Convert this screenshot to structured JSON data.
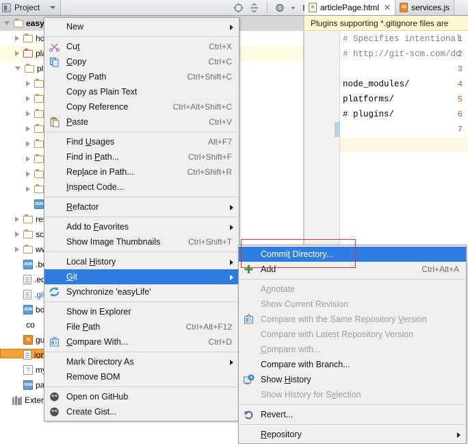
{
  "toolbar": {
    "project_label": "Project",
    "icons": [
      "target-icon",
      "collapse-all-icon",
      "settings-gear-icon",
      "hide-panel-icon"
    ]
  },
  "project_tree": {
    "rows": [
      {
        "label": "easyLi",
        "indent": 0,
        "twisty": "open",
        "icon": "folder",
        "state": "selected"
      },
      {
        "label": "ho",
        "indent": 1,
        "twisty": "closed",
        "icon": "folder",
        "state": "normal"
      },
      {
        "label": "pla",
        "indent": 1,
        "twisty": "closed",
        "icon": "folder-red",
        "state": "highlight"
      },
      {
        "label": "plu",
        "indent": 1,
        "twisty": "open",
        "icon": "folder",
        "state": "normal"
      },
      {
        "label": "",
        "indent": 2,
        "twisty": "closed",
        "icon": "folder",
        "state": "normal"
      },
      {
        "label": "",
        "indent": 2,
        "twisty": "closed",
        "icon": "folder",
        "state": "normal"
      },
      {
        "label": "",
        "indent": 2,
        "twisty": "closed",
        "icon": "folder",
        "state": "normal"
      },
      {
        "label": "",
        "indent": 2,
        "twisty": "closed",
        "icon": "folder",
        "state": "normal"
      },
      {
        "label": "",
        "indent": 2,
        "twisty": "closed",
        "icon": "folder",
        "state": "normal"
      },
      {
        "label": "",
        "indent": 2,
        "twisty": "closed",
        "icon": "folder",
        "state": "normal"
      },
      {
        "label": "",
        "indent": 2,
        "twisty": "closed",
        "icon": "folder",
        "state": "normal"
      },
      {
        "label": "",
        "indent": 2,
        "twisty": "closed",
        "icon": "folder",
        "state": "normal"
      },
      {
        "label": "",
        "indent": 2,
        "twisty": "none",
        "icon": "json",
        "state": "normal"
      },
      {
        "label": "res",
        "indent": 1,
        "twisty": "closed",
        "icon": "folder",
        "state": "normal"
      },
      {
        "label": "scs",
        "indent": 1,
        "twisty": "closed",
        "icon": "folder",
        "state": "normal"
      },
      {
        "label": "ww",
        "indent": 1,
        "twisty": "closed",
        "icon": "folder",
        "state": "normal"
      },
      {
        "label": ".bo",
        "indent": 1,
        "twisty": "none",
        "icon": "json",
        "state": "normal"
      },
      {
        "label": ".ed",
        "indent": 1,
        "twisty": "none",
        "icon": "file",
        "state": "normal"
      },
      {
        "label": ".git",
        "indent": 1,
        "twisty": "none",
        "icon": "file",
        "state": "link"
      },
      {
        "label": "bo",
        "indent": 1,
        "twisty": "none",
        "icon": "json",
        "state": "normal"
      },
      {
        "label": "co",
        "indent": 1,
        "twisty": "none",
        "icon": "code",
        "state": "normal"
      },
      {
        "label": "gu",
        "indent": 1,
        "twisty": "none",
        "icon": "js",
        "state": "normal"
      },
      {
        "label": "ion",
        "indent": 1,
        "twisty": "none",
        "icon": "file",
        "state": "normal"
      },
      {
        "label": "my",
        "indent": 1,
        "twisty": "none",
        "icon": "question",
        "state": "normal"
      },
      {
        "label": "pa",
        "indent": 1,
        "twisty": "none",
        "icon": "json",
        "state": "normal"
      },
      {
        "label": "Extern",
        "indent": 0,
        "twisty": "none",
        "icon": "library",
        "state": "normal"
      }
    ]
  },
  "editor": {
    "tabs": [
      {
        "label": "articlePage.html",
        "icon": "html-file-icon",
        "active": true,
        "closable": true
      },
      {
        "label": "services.js",
        "icon": "js-file-icon",
        "active": false,
        "closable": false
      }
    ],
    "notification": "Plugins supporting *.gitignore files are",
    "lines": [
      {
        "num": "1",
        "text": "# Specifies intentional",
        "kind": "comment"
      },
      {
        "num": "2",
        "text": "# http://git-scm.com/dc",
        "kind": "comment"
      },
      {
        "num": "3",
        "text": "",
        "kind": "plain"
      },
      {
        "num": "4",
        "text": "node_modules/",
        "kind": "plain"
      },
      {
        "num": "5",
        "text": "platforms/",
        "kind": "plain"
      },
      {
        "num": "6",
        "text": "# plugins/",
        "kind": "plain"
      },
      {
        "num": "7",
        "text": "",
        "kind": "plain"
      }
    ]
  },
  "context_menu": {
    "items": [
      {
        "label": "New",
        "accel": "",
        "icon": "",
        "arrow": true,
        "type": "item"
      },
      {
        "type": "separator"
      },
      {
        "label": "Cut",
        "accel": "Ctrl+X",
        "icon": "scissors-icon",
        "mnemonic": 2,
        "type": "item"
      },
      {
        "label": "Copy",
        "accel": "Ctrl+C",
        "icon": "copy-icon",
        "mnemonic": 0,
        "type": "item"
      },
      {
        "label": "Copy Path",
        "accel": "Ctrl+Shift+C",
        "icon": "",
        "mnemonic": 2,
        "type": "item"
      },
      {
        "label": "Copy as Plain Text",
        "accel": "",
        "icon": "",
        "type": "item"
      },
      {
        "label": "Copy Reference",
        "accel": "Ctrl+Alt+Shift+C",
        "icon": "",
        "type": "item"
      },
      {
        "label": "Paste",
        "accel": "Ctrl+V",
        "icon": "paste-icon",
        "mnemonic": 0,
        "type": "item"
      },
      {
        "type": "separator"
      },
      {
        "label": "Find Usages",
        "accel": "Alt+F7",
        "icon": "",
        "mnemonic": 5,
        "type": "item"
      },
      {
        "label": "Find in Path...",
        "accel": "Ctrl+Shift+F",
        "icon": "",
        "mnemonic": 8,
        "type": "item"
      },
      {
        "label": "Replace in Path...",
        "accel": "Ctrl+Shift+R",
        "icon": "",
        "mnemonic": 3,
        "type": "item"
      },
      {
        "label": "Inspect Code...",
        "accel": "",
        "icon": "",
        "mnemonic": 0,
        "type": "item"
      },
      {
        "type": "separator"
      },
      {
        "label": "Refactor",
        "accel": "",
        "icon": "",
        "arrow": true,
        "mnemonic": 0,
        "type": "item"
      },
      {
        "type": "separator"
      },
      {
        "label": "Add to Favorites",
        "accel": "",
        "icon": "",
        "arrow": true,
        "mnemonic": 7,
        "type": "item"
      },
      {
        "label": "Show Image Thumbnails",
        "accel": "Ctrl+Shift+T",
        "icon": "",
        "type": "item"
      },
      {
        "type": "separator"
      },
      {
        "label": "Local History",
        "accel": "",
        "icon": "",
        "arrow": true,
        "mnemonic": 6,
        "type": "item"
      },
      {
        "label": "Git",
        "accel": "",
        "icon": "",
        "arrow": true,
        "mnemonic": 0,
        "selected": true,
        "type": "item"
      },
      {
        "label": "Synchronize 'easyLife'",
        "accel": "",
        "icon": "sync-icon",
        "type": "item"
      },
      {
        "type": "separator"
      },
      {
        "label": "Show in Explorer",
        "accel": "",
        "icon": "",
        "type": "item"
      },
      {
        "label": "File Path",
        "accel": "Ctrl+Alt+F12",
        "icon": "",
        "mnemonic": 5,
        "type": "item"
      },
      {
        "label": "Compare With...",
        "accel": "Ctrl+D",
        "icon": "compare-icon",
        "mnemonic": 0,
        "type": "item"
      },
      {
        "type": "separator"
      },
      {
        "label": "Mark Directory As",
        "accel": "",
        "icon": "",
        "arrow": true,
        "type": "item"
      },
      {
        "label": "Remove BOM",
        "accel": "",
        "icon": "",
        "type": "item"
      },
      {
        "type": "separator"
      },
      {
        "label": "Open on GitHub",
        "accel": "",
        "icon": "github-icon",
        "type": "item"
      },
      {
        "label": "Create Gist...",
        "accel": "",
        "icon": "github-icon",
        "type": "item"
      }
    ]
  },
  "git_submenu": {
    "items": [
      {
        "label": "Commit Directory...",
        "accel": "",
        "icon": "",
        "selected": true,
        "mnemonic": 5,
        "type": "item"
      },
      {
        "label": "Add",
        "accel": "Ctrl+Alt+A",
        "icon": "plus-icon",
        "type": "item"
      },
      {
        "type": "separator"
      },
      {
        "label": "Annotate",
        "accel": "",
        "icon": "",
        "disabled": true,
        "mnemonic": 1,
        "type": "item"
      },
      {
        "label": "Show Current Revision",
        "accel": "",
        "icon": "",
        "disabled": true,
        "type": "item"
      },
      {
        "label": "Compare with the Same Repository Version",
        "accel": "",
        "icon": "compare-icon",
        "disabled": true,
        "mnemonic": 33,
        "type": "item"
      },
      {
        "label": "Compare with Latest Repository Version",
        "accel": "",
        "icon": "",
        "disabled": true,
        "mnemonic": 29,
        "type": "item"
      },
      {
        "label": "Compare with...",
        "accel": "",
        "icon": "",
        "disabled": true,
        "mnemonic": 0,
        "type": "item"
      },
      {
        "label": "Compare with Branch...",
        "accel": "",
        "icon": "",
        "type": "item"
      },
      {
        "label": "Show History",
        "accel": "",
        "icon": "history-icon",
        "mnemonic": 5,
        "type": "item"
      },
      {
        "label": "Show History for Selection",
        "accel": "",
        "icon": "",
        "disabled": true,
        "mnemonic": 18,
        "type": "item"
      },
      {
        "type": "separator"
      },
      {
        "label": "Revert...",
        "accel": "",
        "icon": "revert-icon",
        "type": "item"
      },
      {
        "type": "separator"
      },
      {
        "label": "Repository",
        "accel": "",
        "icon": "",
        "arrow": true,
        "mnemonic": 0,
        "type": "item"
      }
    ]
  },
  "annotation": {
    "highlight_color": "#e03127",
    "target": "Commit Directory..."
  }
}
